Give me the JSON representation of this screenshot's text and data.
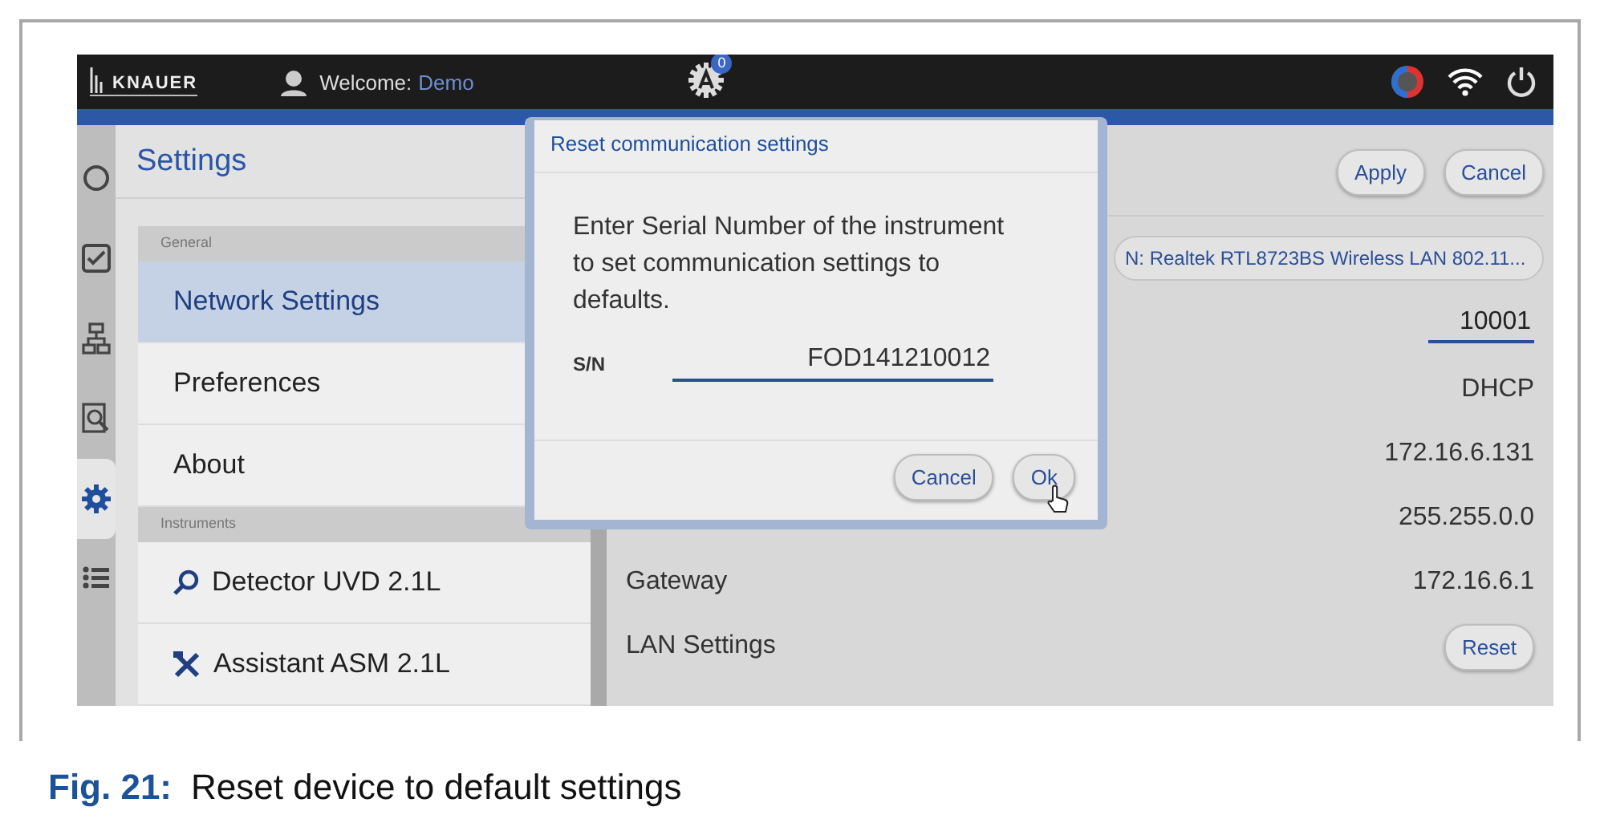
{
  "figure": {
    "app": {
      "top_bar": {
        "brand": "KNAUER",
        "welcome_label": "Welcome:",
        "user": "Demo",
        "badge": "0"
      },
      "rail": [
        {
          "kind": "circle",
          "selected": false
        },
        {
          "kind": "checkbox",
          "selected": false
        },
        {
          "kind": "flowchart",
          "selected": false
        },
        {
          "kind": "inspect",
          "selected": false
        },
        {
          "kind": "gear",
          "selected": true
        },
        {
          "kind": "list",
          "selected": false
        }
      ],
      "settings": {
        "title": "Settings",
        "sections": [
          {
            "label": "General",
            "items": [
              {
                "label": "Network Settings",
                "selected": true
              },
              {
                "label": "Preferences",
                "selected": false
              },
              {
                "label": "About",
                "selected": false
              }
            ]
          },
          {
            "label": "Instruments",
            "items": [
              {
                "label": "Detector UVD 2.1L",
                "selected": false
              },
              {
                "label": "Assistant ASM 2.1L",
                "selected": false
              }
            ]
          }
        ]
      },
      "detail": {
        "buttons": [
          "Apply",
          "Cancel"
        ],
        "adapter": "N: Realtek RTL8723BS Wireless LAN 802.11...",
        "rows": [
          {
            "kind": "field",
            "value": "10001"
          },
          {
            "kind": "text",
            "value": "DHCP"
          },
          {
            "kind": "text",
            "value": "172.16.6.131"
          },
          {
            "kind": "text",
            "value": "255.255.0.0"
          },
          {
            "kind": "text",
            "label": "Gateway",
            "value": "172.16.6.1"
          },
          {
            "kind": "button",
            "label": "LAN Settings",
            "value": "Reset"
          }
        ]
      },
      "dialog": {
        "title": "Reset communication settings",
        "message": "Enter Serial Number of the instrument to set communication settings to defaults.",
        "field_label": "S/N",
        "value": "FOD141210012",
        "buttons": [
          "Cancel",
          "Ok"
        ]
      }
    },
    "caption": {
      "label": "Fig. 21:",
      "text": "Reset device to default settings"
    }
  }
}
